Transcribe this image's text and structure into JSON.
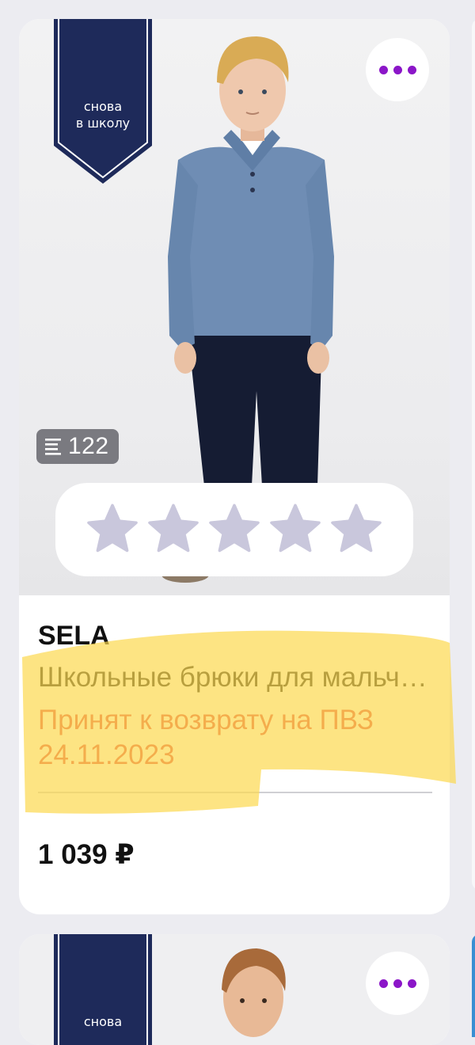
{
  "colors": {
    "accent_purple": "#8b16c8",
    "status_red": "#e24646",
    "ribbon_navy": "#1e2a5a",
    "star_empty": "#c9c7dc",
    "highlighter_yellow": "#fcd94f"
  },
  "product_card": {
    "badge_text": "снова\nв школу",
    "more_icon": "more-dots-icon",
    "reviews": {
      "icon": "list-icon",
      "count": "122"
    },
    "rating": {
      "stars_filled": 0,
      "stars_total": 5
    },
    "brand": "SELA",
    "title": "Школьные брюки для мальчика",
    "status": "Принят к возврату на ПВЗ 24.11.2023",
    "price": "1 039 ₽"
  },
  "next_card": {
    "badge_text": "снова",
    "more_icon": "more-dots-icon"
  }
}
